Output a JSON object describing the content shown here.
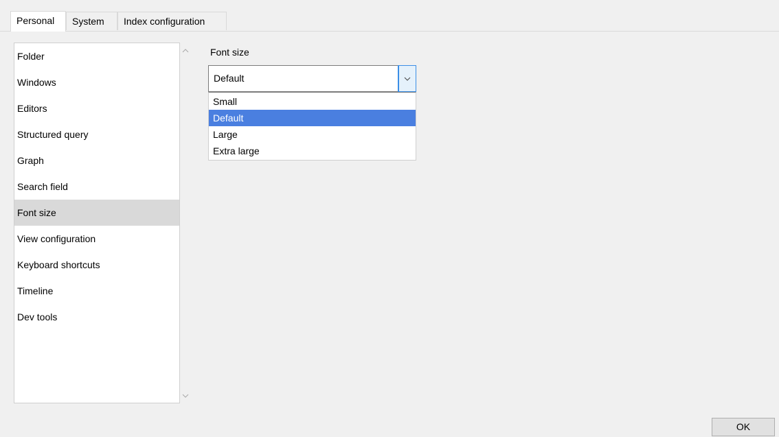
{
  "tabs": [
    {
      "label": "Personal",
      "active": true
    },
    {
      "label": "System",
      "active": false
    },
    {
      "label": "Index configuration",
      "active": false
    }
  ],
  "sidebar": {
    "items": [
      {
        "label": "Folder"
      },
      {
        "label": "Windows"
      },
      {
        "label": "Editors"
      },
      {
        "label": "Structured query"
      },
      {
        "label": "Graph"
      },
      {
        "label": "Search field"
      },
      {
        "label": "Font size",
        "selected": true
      },
      {
        "label": "View configuration"
      },
      {
        "label": "Keyboard shortcuts"
      },
      {
        "label": "Timeline"
      },
      {
        "label": "Dev tools"
      }
    ],
    "scroll_up_icon": "chevron-up-icon",
    "scroll_down_icon": "chevron-down-icon"
  },
  "main": {
    "section_label": "Font size",
    "font_size_select": {
      "value": "Default",
      "options": [
        "Small",
        "Default",
        "Large",
        "Extra large"
      ],
      "highlighted": "Default",
      "button_icon": "chevron-down-icon"
    }
  },
  "footer": {
    "ok_label": "OK"
  },
  "colors": {
    "highlight": "#4a7fe0",
    "selected_item": "#d9d9d9",
    "window_bg": "#f0f0f0"
  }
}
